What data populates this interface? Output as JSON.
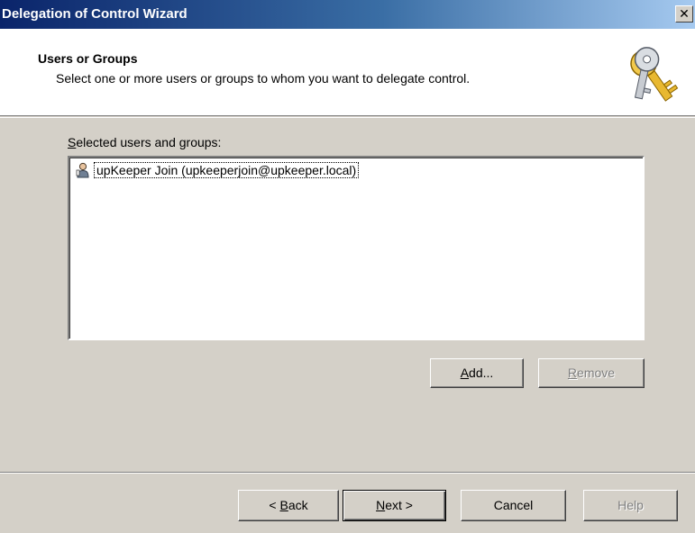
{
  "window": {
    "title": "Delegation of Control Wizard",
    "close_glyph": "✕"
  },
  "header": {
    "title": "Users or Groups",
    "subtitle": "Select one or more users or groups to whom you want to delegate control.",
    "icon": "keys-icon"
  },
  "selected_list": {
    "label_accel": "S",
    "label_rest": "elected users and groups:",
    "items": [
      {
        "icon": "user-icon",
        "label": "upKeeper Join (upkeeperjoin@upkeeper.local)"
      }
    ]
  },
  "list_buttons": {
    "add_accel": "A",
    "add_rest": "dd...",
    "remove_accel": "R",
    "remove_rest": "emove"
  },
  "footer_buttons": {
    "back_prefix": "< ",
    "back_accel": "B",
    "back_rest": "ack",
    "next_accel": "N",
    "next_rest": "ext >",
    "cancel": "Cancel",
    "help": "Help"
  }
}
